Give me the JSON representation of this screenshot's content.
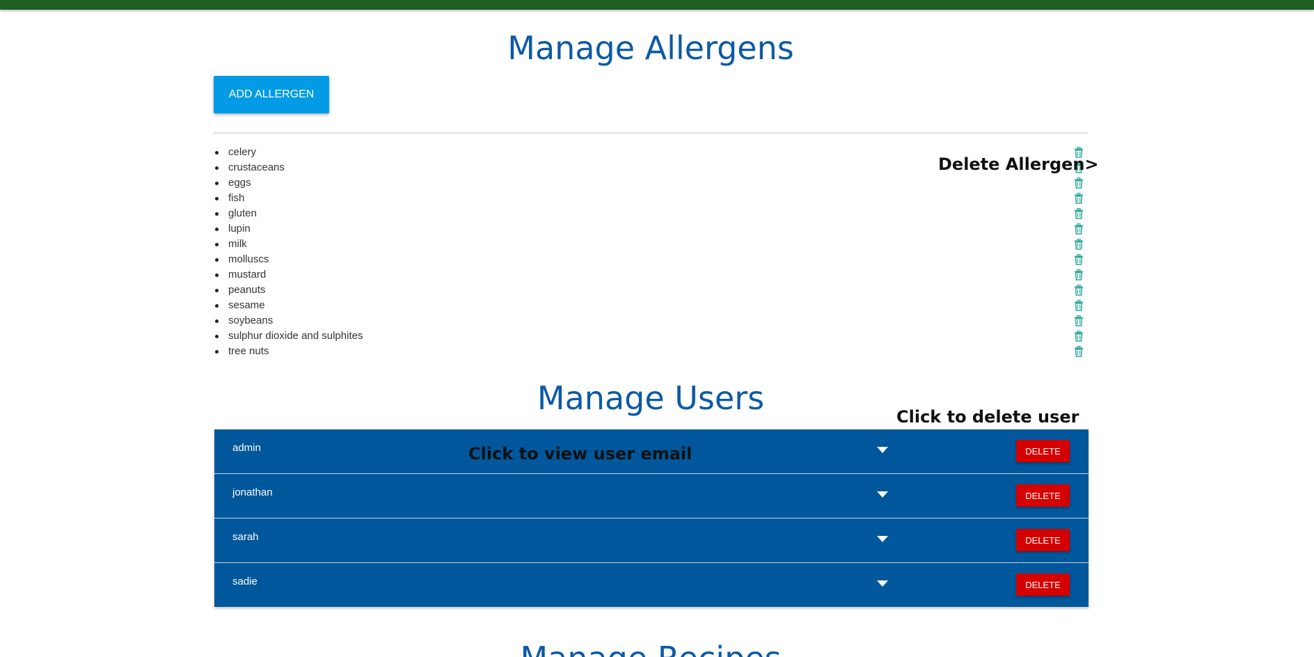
{
  "allergens": {
    "title": "Manage Allergens",
    "add_button_label": "ADD ALLERGEN",
    "items": [
      "celery",
      "crustaceans",
      "eggs",
      "fish",
      "gluten",
      "lupin",
      "milk",
      "molluscs",
      "mustard",
      "peanuts",
      "sesame",
      "soybeans",
      "sulphur dioxide and sulphites",
      "tree nuts"
    ],
    "delete_icon": "trash-icon"
  },
  "annotations": {
    "delete_allergen": "Delete Allergen>",
    "delete_user": "Click to delete user",
    "view_email": "Click to view user email"
  },
  "users": {
    "title": "Manage Users",
    "delete_label": "DELETE",
    "expand_icon": "chevron-down-icon",
    "items": [
      "admin",
      "jonathan",
      "sarah",
      "sadie"
    ]
  },
  "next_section": {
    "title": "Manage Recipes"
  },
  "colors": {
    "top_bar": "#1f5f23",
    "title": "#0d5aa7",
    "add_button": "#039be5",
    "user_row": "#01579b",
    "delete_button": "#d50000",
    "trash_icon": "#26a69a"
  }
}
